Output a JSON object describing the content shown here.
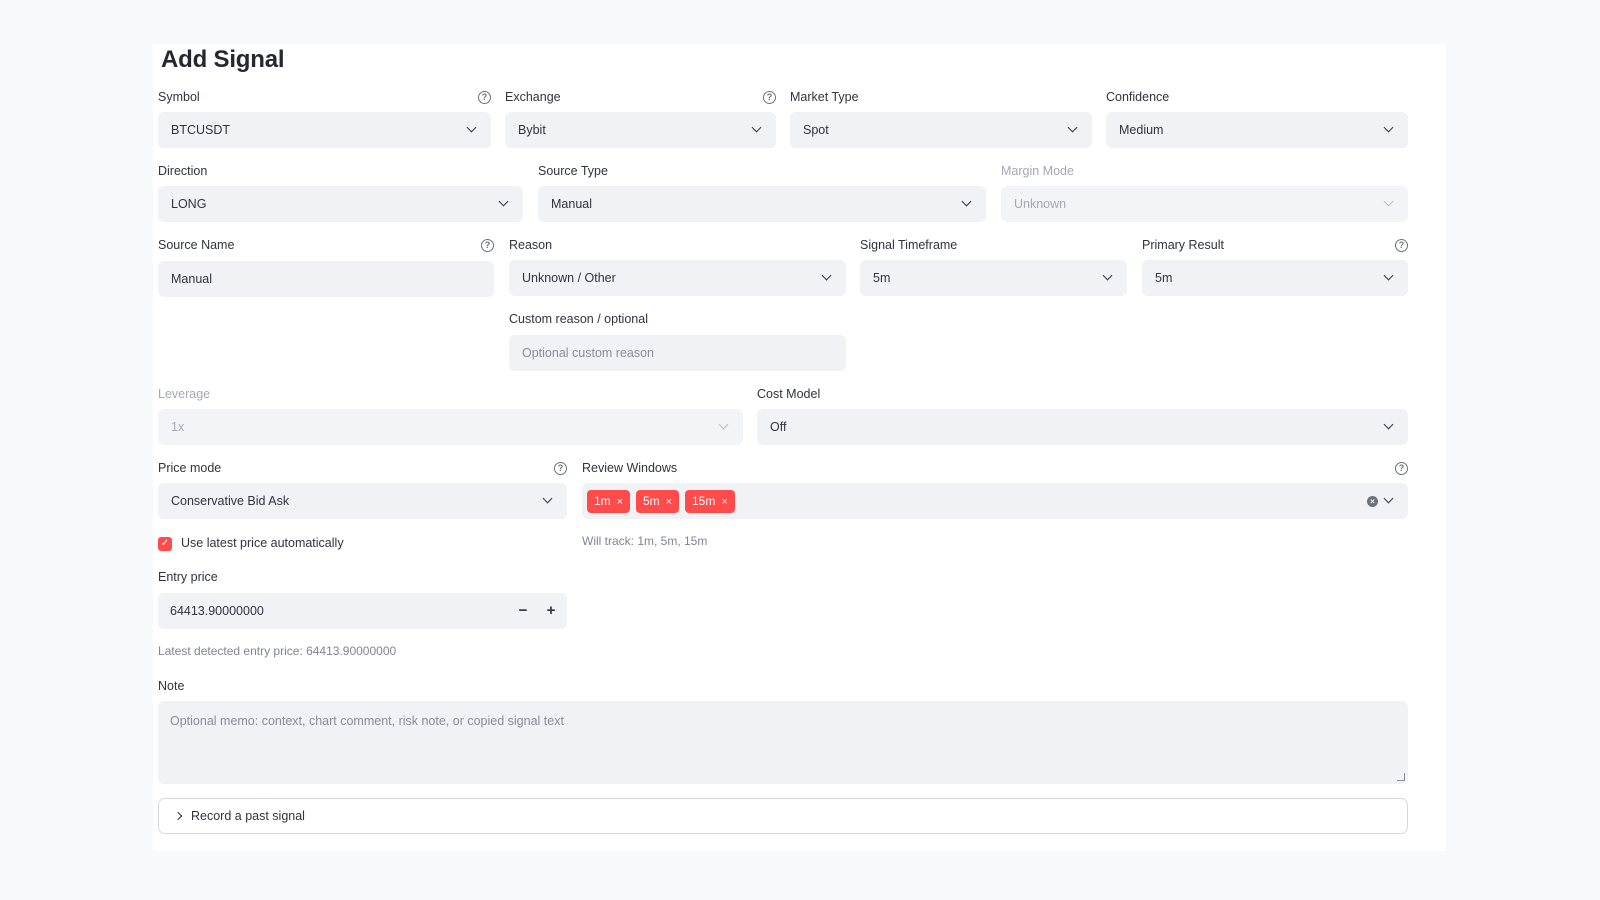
{
  "page": {
    "title": "Add Signal"
  },
  "symbol": {
    "label": "Symbol",
    "value": "BTCUSDT"
  },
  "exchange": {
    "label": "Exchange",
    "value": "Bybit"
  },
  "market_type": {
    "label": "Market Type",
    "value": "Spot"
  },
  "confidence": {
    "label": "Confidence",
    "value": "Medium"
  },
  "direction": {
    "label": "Direction",
    "value": "LONG"
  },
  "source_type": {
    "label": "Source Type",
    "value": "Manual"
  },
  "margin_mode": {
    "label": "Margin Mode",
    "value": "Unknown",
    "disabled": true
  },
  "source_name": {
    "label": "Source Name",
    "value": "Manual"
  },
  "reason": {
    "label": "Reason",
    "value": "Unknown / Other"
  },
  "signal_timeframe": {
    "label": "Signal Timeframe",
    "value": "5m"
  },
  "primary_result": {
    "label": "Primary Result",
    "value": "5m"
  },
  "custom_reason": {
    "label": "Custom reason / optional",
    "placeholder": "Optional custom reason"
  },
  "leverage": {
    "label": "Leverage",
    "value": "1x",
    "disabled": true
  },
  "cost_model": {
    "label": "Cost Model",
    "value": "Off"
  },
  "price_mode": {
    "label": "Price mode",
    "value": "Conservative Bid Ask"
  },
  "review_windows": {
    "label": "Review Windows",
    "tags": [
      "1m",
      "5m",
      "15m"
    ],
    "tag_color": "#ff4b4b",
    "caption": "Will track: 1m, 5m, 15m"
  },
  "use_latest_price": {
    "label": "Use latest price automatically",
    "checked": true
  },
  "entry_price": {
    "label": "Entry price",
    "value": "64413.90000000",
    "minus": "−",
    "plus": "+",
    "caption": "Latest detected entry price: 64413.90000000"
  },
  "note": {
    "label": "Note",
    "placeholder": "Optional memo: context, chart comment, risk note, or copied signal text"
  },
  "expander": {
    "label": "Record a past signal"
  },
  "icons": {
    "help": "question-circle-icon",
    "chevron": "chevron-down-icon",
    "clear": "clear-all-icon",
    "tag_remove": "×",
    "check": "✓"
  },
  "colors": {
    "accent": "#ff4b4b",
    "input_bg": "#f0f2f6",
    "page_bg": "#f8f9fb"
  }
}
